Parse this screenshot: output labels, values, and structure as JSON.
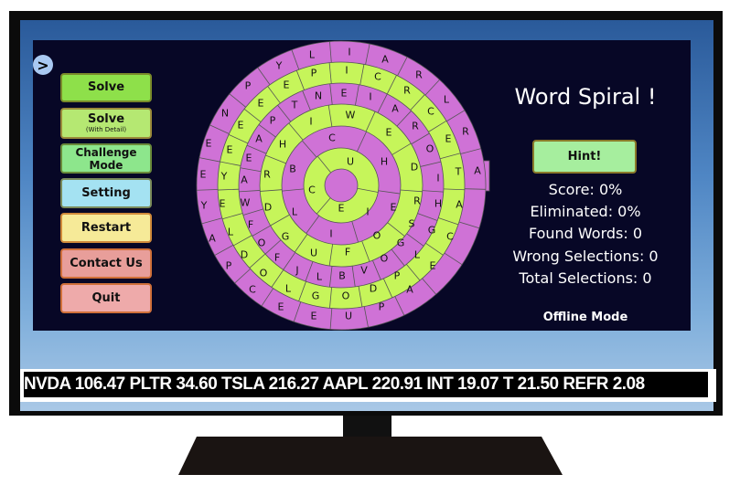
{
  "game": {
    "title": "Word Spiral !",
    "hint_label": "Hint!",
    "stats": [
      "Score: 0%",
      "Eliminated: 0%",
      "Found Words: 0",
      "Wrong Selections: 0",
      "Total Selections: 0"
    ],
    "mode": "Offline Mode",
    "expand_icon": "chevron-right-icon"
  },
  "menu": [
    {
      "label": "Solve",
      "sub": "",
      "color": "#8ee04a",
      "border": "#7a8a2a"
    },
    {
      "label": "Solve",
      "sub": "(With Detail)",
      "color": "#b5e872",
      "border": "#9a8a3a"
    },
    {
      "label": "Challenge Mode",
      "sub": "",
      "color": "#8de68c",
      "border": "#6a8a3a"
    },
    {
      "label": "Setting",
      "sub": "",
      "color": "#a4e2f2",
      "border": "#7a8a5a"
    },
    {
      "label": "Restart",
      "sub": "",
      "color": "#f6ea98",
      "border": "#d08a3a"
    },
    {
      "label": "Contact Us",
      "sub": "",
      "color": "#e89e9a",
      "border": "#d0703a"
    },
    {
      "label": "Quit",
      "sub": "",
      "color": "#eeaaaa",
      "border": "#d0703a"
    }
  ],
  "spiral": {
    "colors": {
      "purple": "#cf72d6",
      "green": "#c6f55a",
      "line": "#555"
    },
    "rings": [
      "IARLRAACEAPUEECPAYEENPYL",
      "YEEEEPICRCETHGLPDOGLODLE",
      "NEIAROIRSGOVBLJFOFWAEAPT",
      "WEDEOFUGDRHI",
      "CHIILB",
      "UEC"
    ]
  },
  "ticker": "NVDA 106.47 PLTR 34.60 TSLA 216.27 AAPL 220.91 INT  19.07 T 21.50 REFR 2.08"
}
